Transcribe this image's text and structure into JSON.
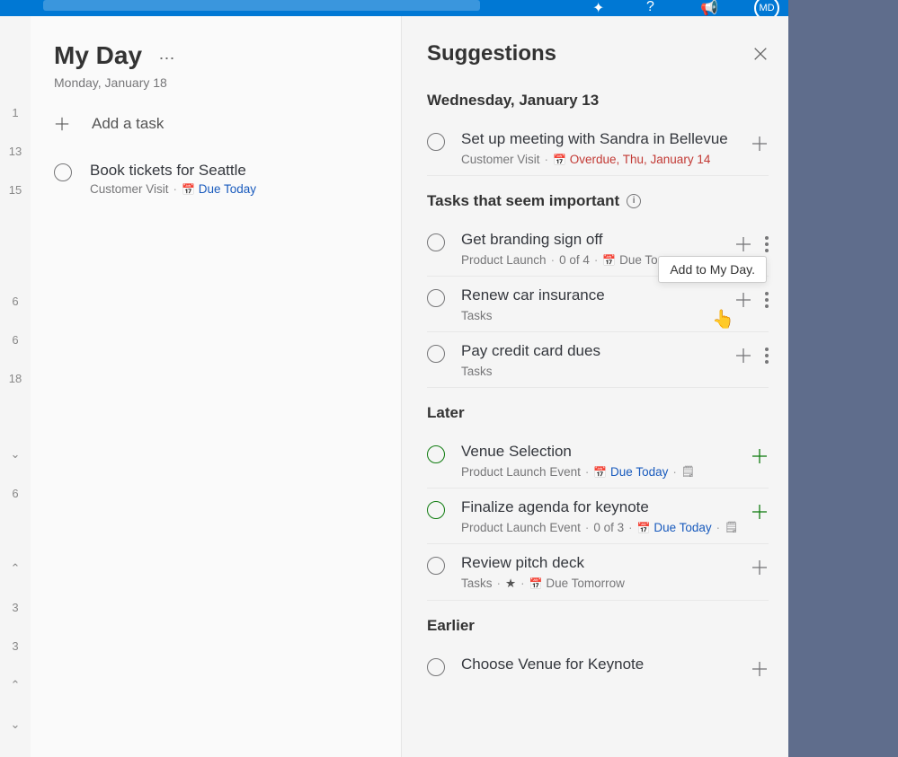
{
  "header": {
    "title": "My Day",
    "date": "Monday, January 18",
    "add_task": "Add a task"
  },
  "tasks": [
    {
      "title": "Book tickets for Seattle",
      "list": "Customer Visit",
      "due_label": "Due Today",
      "due_class": "due"
    }
  ],
  "panel": {
    "title": "Suggestions",
    "tooltip": "Add to My Day."
  },
  "sections": [
    {
      "heading": "Wednesday, January 13",
      "info": false,
      "items": [
        {
          "title": "Set up meeting with Sandra in Bellevue",
          "meta_parts": [
            "Customer Visit"
          ],
          "due_label": "Overdue, Thu, January 14",
          "due_class": "overdue",
          "circle": "",
          "plus": "",
          "more": false
        }
      ]
    },
    {
      "heading": "Tasks that seem important",
      "info": true,
      "items": [
        {
          "title": "Get branding sign off",
          "meta_parts": [
            "Product Launch",
            "0 of 4"
          ],
          "due_label": "Due Tomorrow",
          "due_class": "",
          "circle": "",
          "plus": "",
          "more": true,
          "hover": true
        },
        {
          "title": "Renew car insurance",
          "meta_parts": [
            "Tasks"
          ],
          "due_label": "",
          "circle": "",
          "plus": "",
          "more": true
        },
        {
          "title": "Pay credit card dues",
          "meta_parts": [
            "Tasks"
          ],
          "due_label": "",
          "circle": "",
          "plus": "",
          "more": true
        }
      ]
    },
    {
      "heading": "Later",
      "info": false,
      "items": [
        {
          "title": "Venue Selection",
          "meta_parts": [
            "Product Launch Event"
          ],
          "due_label": "Due Today",
          "due_class": "due",
          "note": true,
          "circle": "green",
          "plus": "green",
          "more": false
        },
        {
          "title": "Finalize agenda for keynote",
          "meta_parts": [
            "Product Launch Event",
            "0 of 3"
          ],
          "due_label": "Due Today",
          "due_class": "due",
          "note": true,
          "circle": "green",
          "plus": "green",
          "more": false
        },
        {
          "title": "Review pitch deck",
          "meta_parts": [
            "Tasks"
          ],
          "star": true,
          "due_label": "Due Tomorrow",
          "due_class": "",
          "circle": "",
          "plus": "",
          "more": false
        }
      ]
    },
    {
      "heading": "Earlier",
      "info": false,
      "items": [
        {
          "title": "Choose Venue for Keynote",
          "meta_parts": [],
          "due_label": "",
          "circle": "",
          "plus": "",
          "more": false
        }
      ]
    }
  ],
  "gutter": [
    "1",
    "13",
    "15",
    "",
    "",
    "6",
    "6",
    "18",
    "",
    "⌄",
    "6",
    "",
    "⌃",
    "3",
    "3",
    "⌃",
    "⌄"
  ],
  "avatar_text": "MD"
}
